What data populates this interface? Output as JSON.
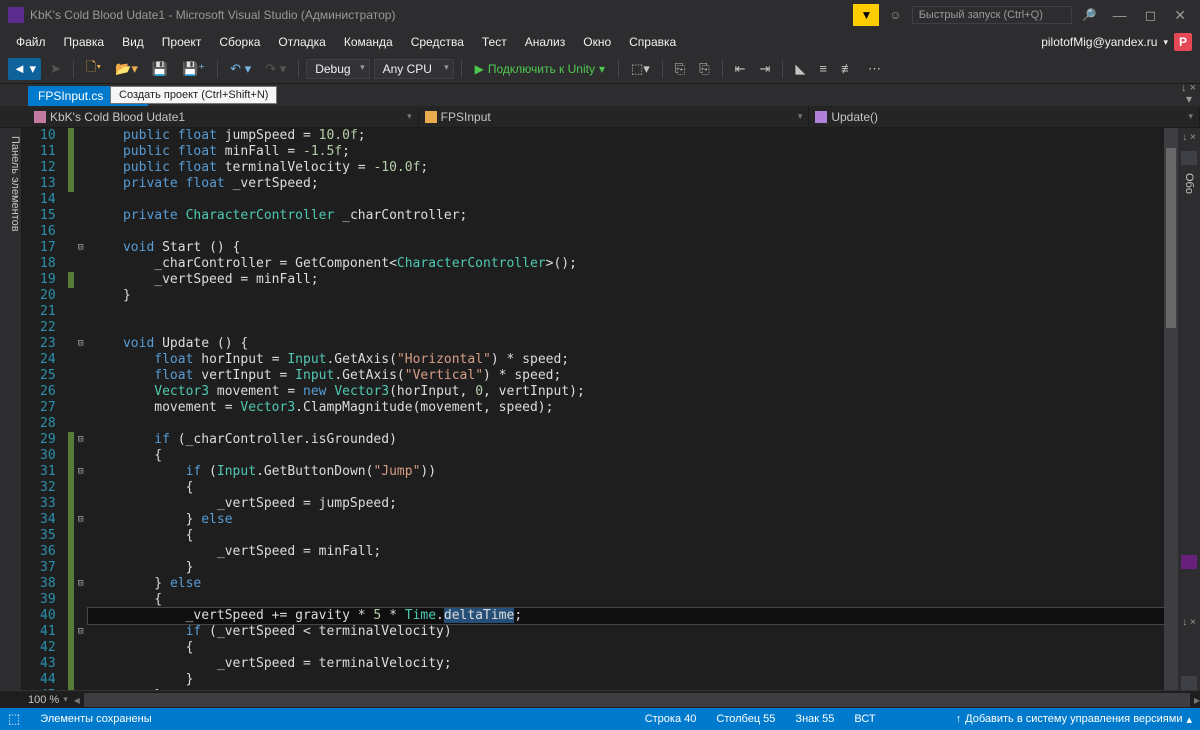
{
  "title": "KbK's Cold Blood Udate1 - Microsoft Visual Studio  (Администратор)",
  "search_placeholder": "Быстрый запуск (Ctrl+Q)",
  "menu": [
    "Файл",
    "Правка",
    "Вид",
    "Проект",
    "Сборка",
    "Отладка",
    "Команда",
    "Средства",
    "Тест",
    "Анализ",
    "Окно",
    "Справка"
  ],
  "user_email": "pilotofMig@yandex.ru",
  "user_badge": "P",
  "toolbar": {
    "config": "Debug",
    "platform": "Any CPU",
    "attach": "Подключить к Unity"
  },
  "tab": {
    "name": "FPSInput.cs",
    "close": "✕"
  },
  "tab_tooltip": "Создать проект (Ctrl+Shift+N)",
  "nav": {
    "project": "KbK's Cold Blood Udate1",
    "class": "FPSInput",
    "member": "Update()"
  },
  "left_panel": "Панель элементов",
  "right_panel_short": "Обо",
  "code_start_line": 10,
  "code": [
    {
      "fold": "",
      "chg": "g",
      "html": "    <span class='kw'>public</span> <span class='kw'>float</span> jumpSpeed = <span class='nm'>10.0f</span>;"
    },
    {
      "fold": "",
      "chg": "g",
      "html": "    <span class='kw'>public</span> <span class='kw'>float</span> minFall = <span class='nm'>-1.5f</span>;"
    },
    {
      "fold": "",
      "chg": "g",
      "html": "    <span class='kw'>public</span> <span class='kw'>float</span> terminalVelocity = <span class='nm'>-10.0f</span>;"
    },
    {
      "fold": "",
      "chg": "g",
      "html": "    <span class='kw'>private</span> <span class='kw'>float</span> _vertSpeed;"
    },
    {
      "fold": "",
      "chg": "",
      "html": ""
    },
    {
      "fold": "",
      "chg": "",
      "html": "    <span class='kw'>private</span> <span class='tp'>CharacterController</span> _charController;"
    },
    {
      "fold": "",
      "chg": "",
      "html": ""
    },
    {
      "fold": "⊟",
      "chg": "",
      "html": "    <span class='kw'>void</span> Start () {"
    },
    {
      "fold": "",
      "chg": "",
      "html": "        _charController = GetComponent&lt;<span class='tp'>CharacterController</span>&gt;();"
    },
    {
      "fold": "",
      "chg": "g",
      "html": "        _vertSpeed = minFall;"
    },
    {
      "fold": "",
      "chg": "",
      "html": "    }"
    },
    {
      "fold": "",
      "chg": "",
      "html": ""
    },
    {
      "fold": "",
      "chg": "",
      "html": ""
    },
    {
      "fold": "⊟",
      "chg": "",
      "html": "    <span class='kw'>void</span> Update () {"
    },
    {
      "fold": "",
      "chg": "",
      "html": "        <span class='kw'>float</span> horInput = <span class='tp'>Input</span>.GetAxis(<span class='st'>\"Horizontal\"</span>) * speed;"
    },
    {
      "fold": "",
      "chg": "",
      "html": "        <span class='kw'>float</span> vertInput = <span class='tp'>Input</span>.GetAxis(<span class='st'>\"Vertical\"</span>) * speed;"
    },
    {
      "fold": "",
      "chg": "",
      "html": "        <span class='tp'>Vector3</span> movement = <span class='kw'>new</span> <span class='tp'>Vector3</span>(horInput, <span class='nm'>0</span>, vertInput);"
    },
    {
      "fold": "",
      "chg": "",
      "html": "        movement = <span class='tp'>Vector3</span>.ClampMagnitude(movement, speed);"
    },
    {
      "fold": "",
      "chg": "",
      "html": ""
    },
    {
      "fold": "⊟",
      "chg": "g",
      "html": "        <span class='kw'>if</span> (_charController.isGrounded)"
    },
    {
      "fold": "",
      "chg": "g",
      "html": "        {"
    },
    {
      "fold": "⊟",
      "chg": "g",
      "html": "            <span class='kw'>if</span> (<span class='tp'>Input</span>.GetButtonDown(<span class='st'>\"Jump\"</span>))"
    },
    {
      "fold": "",
      "chg": "g",
      "html": "            {"
    },
    {
      "fold": "",
      "chg": "g",
      "html": "                _vertSpeed = jumpSpeed;"
    },
    {
      "fold": "⊟",
      "chg": "g",
      "html": "            } <span class='kw'>else</span>"
    },
    {
      "fold": "",
      "chg": "g",
      "html": "            {"
    },
    {
      "fold": "",
      "chg": "g",
      "html": "                _vertSpeed = minFall;"
    },
    {
      "fold": "",
      "chg": "g",
      "html": "            }"
    },
    {
      "fold": "⊟",
      "chg": "g",
      "html": "        } <span class='kw'>else</span>"
    },
    {
      "fold": "",
      "chg": "g",
      "html": "        {"
    },
    {
      "fold": "",
      "chg": "g",
      "hl": true,
      "html": "            _vertSpeed += gravity * <span class='nm'>5</span> * <span class='tp'>Time</span>.<span class='sel'>deltaTime</span>;"
    },
    {
      "fold": "⊟",
      "chg": "g",
      "html": "            <span class='kw'>if</span> (_vertSpeed &lt; terminalVelocity)"
    },
    {
      "fold": "",
      "chg": "g",
      "html": "            {"
    },
    {
      "fold": "",
      "chg": "g",
      "html": "                _vertSpeed = terminalVelocity;"
    },
    {
      "fold": "",
      "chg": "g",
      "html": "            }"
    },
    {
      "fold": "",
      "chg": "g",
      "html": "        }"
    },
    {
      "fold": "",
      "chg": "",
      "html": ""
    }
  ],
  "zoom": "100 %",
  "status": {
    "saved": "Элементы сохранены",
    "line": "Строка 40",
    "col": "Столбец 55",
    "char": "Знак 55",
    "ins": "ВСТ",
    "vcs": "Добавить в систему управления версиями"
  }
}
